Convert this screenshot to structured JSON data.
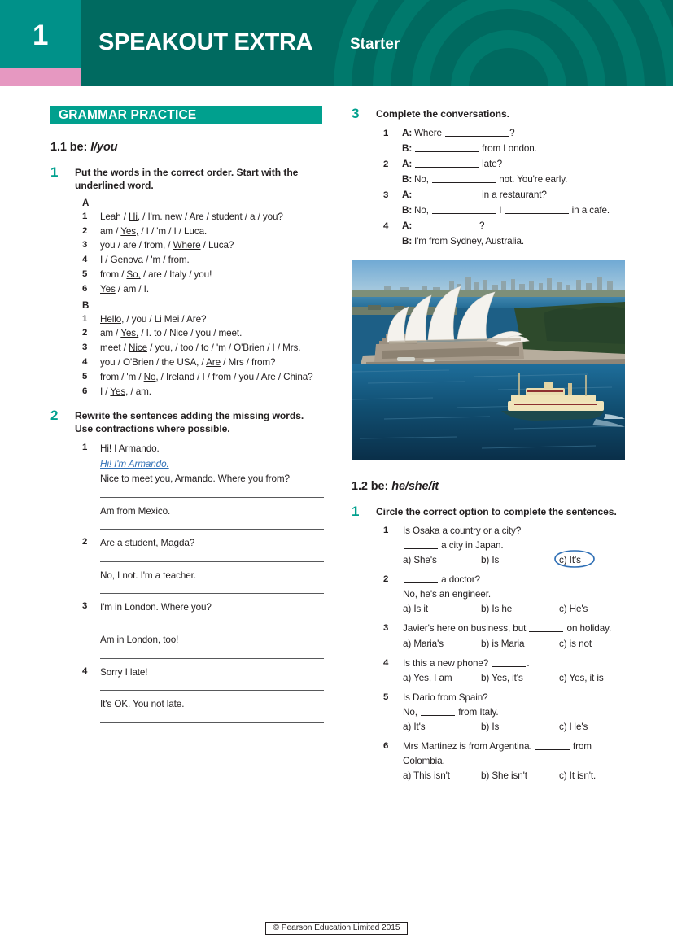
{
  "header": {
    "unit_number": "1",
    "brand_title": "SPEAKOUT EXTRA",
    "level": "Starter",
    "colors": {
      "header_dark_teal": "#006a60",
      "unit_block_teal": "#009189",
      "pink_accent": "#e698c1",
      "arc_teal": "#00796c"
    }
  },
  "section": {
    "bar_label": "GRAMMAR PRACTICE",
    "bar_color": "#00a08e"
  },
  "grammar_points": [
    {
      "id": "1.1",
      "number": "1.1",
      "be_label": "be:",
      "forms": "I/you"
    },
    {
      "id": "1.2",
      "number": "1.2",
      "be_label": "be:",
      "forms": "he/she/it"
    }
  ],
  "exercise_1": {
    "number": "1",
    "rubric": "Put the words in the correct order. Start with the underlined word.",
    "groups": [
      {
        "label": "A",
        "items": [
          {
            "num": "1",
            "parts": [
              "Leah / ",
              "Hi,",
              " / I'm. new / Are / student / a / you?"
            ],
            "underline_index": 1
          },
          {
            "num": "2",
            "parts": [
              "am / ",
              "Yes,",
              " / I / 'm / I / Luca."
            ],
            "underline_index": 1
          },
          {
            "num": "3",
            "parts": [
              "you / are / from, / ",
              "Where",
              " / Luca?"
            ],
            "underline_index": 1
          },
          {
            "num": "4",
            "parts": [
              "",
              "I",
              " / Genova / 'm / from."
            ],
            "underline_index": 1
          },
          {
            "num": "5",
            "parts": [
              "from / ",
              "So,",
              " / are / Italy / you!"
            ],
            "underline_index": 1
          },
          {
            "num": "6",
            "parts": [
              "",
              "Yes",
              " / am / I."
            ],
            "underline_index": 1
          }
        ]
      },
      {
        "label": "B",
        "items": [
          {
            "num": "1",
            "parts": [
              "",
              "Hello,",
              " / you / Li Mei / Are?"
            ],
            "underline_index": 1
          },
          {
            "num": "2",
            "parts": [
              "am / ",
              "Yes,",
              " / I. to / Nice / you / meet."
            ],
            "underline_index": 1
          },
          {
            "num": "3",
            "parts": [
              "meet / ",
              "Nice",
              " / you, / too / to / 'm / O'Brien / I / Mrs."
            ],
            "underline_index": 1
          },
          {
            "num": "4",
            "parts": [
              "you / O'Brien / the USA, / ",
              "Are",
              " / Mrs / from?"
            ],
            "underline_index": 1
          },
          {
            "num": "5",
            "parts": [
              "from / 'm / ",
              "No,",
              " / Ireland / I / from / you / Are / China?"
            ],
            "underline_index": 1
          },
          {
            "num": "6",
            "parts": [
              "I / ",
              "Yes,",
              " / am."
            ],
            "underline_index": 1
          }
        ]
      }
    ]
  },
  "exercise_2": {
    "number": "2",
    "rubric": "Rewrite the sentences adding the missing words. Use contractions where possible.",
    "items": [
      {
        "num": "1",
        "lines": [
          {
            "type": "prompt",
            "text": "Hi! I Armando."
          },
          {
            "type": "answer",
            "text": "Hi! I'm Armando."
          },
          {
            "type": "prompt",
            "text": "Nice to meet you, Armando. Where you from?"
          },
          {
            "type": "rule"
          },
          {
            "type": "prompt",
            "text": "Am from Mexico."
          },
          {
            "type": "rule"
          }
        ]
      },
      {
        "num": "2",
        "lines": [
          {
            "type": "prompt",
            "text": "Are a student, Magda?"
          },
          {
            "type": "rule"
          },
          {
            "type": "prompt",
            "text": "No, I not. I'm a teacher."
          },
          {
            "type": "rule"
          }
        ]
      },
      {
        "num": "3",
        "lines": [
          {
            "type": "prompt",
            "text": "I'm in London. Where you?"
          },
          {
            "type": "rule"
          },
          {
            "type": "prompt",
            "text": "Am in London, too!"
          },
          {
            "type": "rule"
          }
        ]
      },
      {
        "num": "4",
        "lines": [
          {
            "type": "prompt",
            "text": "Sorry I late!"
          },
          {
            "type": "rule"
          },
          {
            "type": "prompt",
            "text": "It's OK. You not late."
          },
          {
            "type": "rule"
          }
        ]
      }
    ]
  },
  "exercise_3": {
    "number": "3",
    "rubric": "Complete the conversations.",
    "items": [
      {
        "num": "1",
        "lines": [
          {
            "speaker": "A:",
            "segments": [
              "Where ",
              "BLANK",
              "?"
            ]
          },
          {
            "speaker": "B:",
            "segments": [
              "",
              "BLANK",
              " from London."
            ]
          }
        ]
      },
      {
        "num": "2",
        "lines": [
          {
            "speaker": "A:",
            "segments": [
              "",
              "BLANK",
              " late?"
            ]
          },
          {
            "speaker": "B:",
            "segments": [
              "No, ",
              "BLANK",
              " not. You're early."
            ]
          }
        ]
      },
      {
        "num": "3",
        "lines": [
          {
            "speaker": "A:",
            "segments": [
              "",
              "BLANK",
              " in a restaurant?"
            ]
          },
          {
            "speaker": "B:",
            "segments": [
              "No, ",
              "BLANK",
              " I ",
              "BLANK",
              " in a cafe."
            ]
          }
        ]
      },
      {
        "num": "4",
        "lines": [
          {
            "speaker": "A:",
            "segments": [
              "",
              "BLANK",
              "?"
            ]
          },
          {
            "speaker": "B:",
            "segments": [
              "I'm from Sydney, Australia."
            ]
          }
        ]
      }
    ]
  },
  "photo": {
    "caption_alt": "Aerial view of Sydney Opera House on the harbour with a ferry and the city skyline behind",
    "colors": {
      "sky": "#7fb4d8",
      "water_near": "#0d4a6b",
      "water_far": "#1d6f9c",
      "sails": "#f3f1ec",
      "land": "#8d9a72",
      "trees": "#2e4a2c",
      "ferry_hull": "#1c4a4a",
      "ferry_body": "#f0e3b8"
    }
  },
  "exercise_1_2": {
    "number": "1",
    "rubric": "Circle the correct option to complete the sentences.",
    "items": [
      {
        "num": "1",
        "stem": "Is Osaka a country or a city?",
        "stem2_pre": "",
        "stem2_post": " a city in Japan.",
        "stem2_has_blank": true,
        "options": [
          {
            "key": "a)",
            "text": "She's"
          },
          {
            "key": "b)",
            "text": "Is"
          },
          {
            "key": "c)",
            "text": "It's"
          }
        ],
        "circled": "c"
      },
      {
        "num": "2",
        "stem_pre": "",
        "stem_post": " a doctor?",
        "stem_has_blank": true,
        "stem2": "No, he's an engineer.",
        "options": [
          {
            "key": "a)",
            "text": "Is it"
          },
          {
            "key": "b)",
            "text": "Is he"
          },
          {
            "key": "c)",
            "text": "He's"
          }
        ],
        "circled": null
      },
      {
        "num": "3",
        "stem_pre": "Javier's here on business, but ",
        "stem_post": " on holiday.",
        "stem_has_blank": true,
        "options": [
          {
            "key": "a)",
            "text": "Maria's"
          },
          {
            "key": "b)",
            "text": "is Maria"
          },
          {
            "key": "c)",
            "text": "is not"
          }
        ],
        "circled": null
      },
      {
        "num": "4",
        "stem_pre": "Is this a new phone? ",
        "stem_post": ".",
        "stem_has_blank": true,
        "options": [
          {
            "key": "a)",
            "text": "Yes, I am"
          },
          {
            "key": "b)",
            "text": "Yes, it's"
          },
          {
            "key": "c)",
            "text": "Yes, it is"
          }
        ],
        "circled": null
      },
      {
        "num": "5",
        "stem": "Is Dario from Spain?",
        "stem2_pre": "No, ",
        "stem2_post": " from Italy.",
        "stem2_has_blank": true,
        "options": [
          {
            "key": "a)",
            "text": "It's"
          },
          {
            "key": "b)",
            "text": "Is"
          },
          {
            "key": "c)",
            "text": "He's"
          }
        ],
        "circled": null
      },
      {
        "num": "6",
        "stem_pre": "Mrs Martinez is from Argentina. ",
        "stem_post": " from Colombia.",
        "stem_has_blank": true,
        "options": [
          {
            "key": "a)",
            "text": "This isn't"
          },
          {
            "key": "b)",
            "text": "She isn't"
          },
          {
            "key": "c)",
            "text": "It isn't."
          }
        ],
        "circled": null
      }
    ]
  },
  "footer": {
    "copyright": "© Pearson Education Limited 2015"
  }
}
